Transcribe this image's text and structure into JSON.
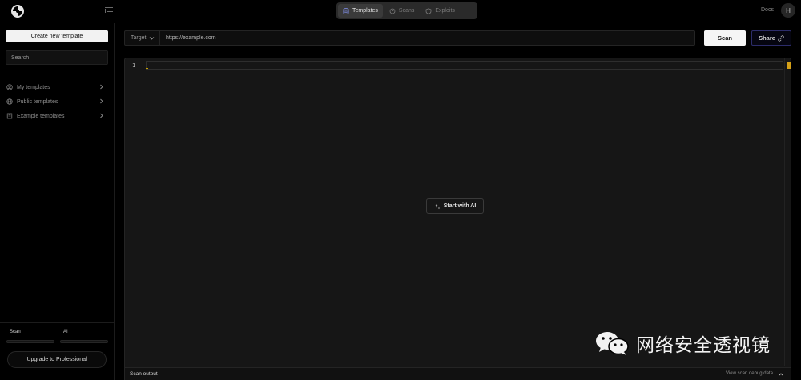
{
  "header": {
    "nav_tabs": [
      {
        "label": "Templates",
        "icon": "database-icon",
        "active": true
      },
      {
        "label": "Scans",
        "icon": "radar-icon",
        "active": false
      },
      {
        "label": "Exploits",
        "icon": "shield-icon",
        "active": false
      }
    ],
    "docs_label": "Docs",
    "avatar_initial": "H"
  },
  "sidebar": {
    "create_button_label": "Create new template",
    "search_placeholder": "Search",
    "items": [
      {
        "label": "My templates",
        "icon": "user-circle-icon"
      },
      {
        "label": "Public templates",
        "icon": "globe-icon"
      },
      {
        "label": "Example templates",
        "icon": "book-icon"
      }
    ],
    "usage": {
      "scan_label": "Scan",
      "ai_label": "AI",
      "scan_fraction": 0.0,
      "ai_fraction": 0.0
    },
    "upgrade_button_label": "Upgrade to Professional"
  },
  "target": {
    "select_label": "Target",
    "input_placeholder": "https://example.com"
  },
  "actions": {
    "scan_label": "Scan",
    "share_label": "Share"
  },
  "editor": {
    "line_numbers": [
      "1"
    ],
    "start_ai_label": "Start with AI"
  },
  "scan_output": {
    "title": "Scan output",
    "debug_link_label": "View scan debug data"
  },
  "watermark": {
    "text": "网络安全透视镜"
  },
  "colors": {
    "background": "#000000",
    "editor_bg": "#161616",
    "accent_share_border": "#2c2c6a",
    "cursor_yellow": "#d4a017"
  }
}
